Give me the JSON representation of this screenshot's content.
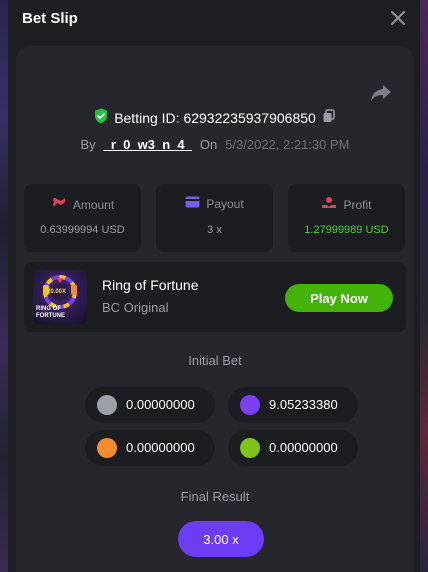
{
  "header": {
    "title": "Bet Slip"
  },
  "bet": {
    "id_label": "Betting ID: 62932235937906850",
    "by_label": "By",
    "username": "_r_0_w3_n_4_",
    "on_label": "On",
    "datetime": "5/3/2022, 2:21:30 PM"
  },
  "stats": [
    {
      "label": "Amount",
      "value": "0.63999994 USD",
      "icon": "amount-icon"
    },
    {
      "label": "Payout",
      "value": "3 x",
      "icon": "wallet-icon"
    },
    {
      "label": "Profit",
      "value": "1.27999989 USD",
      "icon": "profit-icon"
    }
  ],
  "game": {
    "name": "Ring of Fortune",
    "provider": "BC Original",
    "play_label": "Play Now",
    "thumb_text_top": "RING OF",
    "thumb_text_bottom": "FORTUNE",
    "thumb_badge": "20.00X"
  },
  "initial_bet": {
    "title": "Initial Bet",
    "pills": [
      {
        "value": "0.00000000",
        "color": "#9aa0a8"
      },
      {
        "value": "9.05233380",
        "color": "#7b3ff2"
      },
      {
        "value": "0.00000000",
        "color": "#f58a2e"
      },
      {
        "value": "0.00000000",
        "color": "#7fc31c"
      }
    ]
  },
  "final_result": {
    "title": "Final Result",
    "value": "3.00 x"
  },
  "colors": {
    "accent_green": "#43b309",
    "profit_green": "#4fd12b",
    "accent_purple": "#6c3df5",
    "shield_green": "#27c13a"
  }
}
